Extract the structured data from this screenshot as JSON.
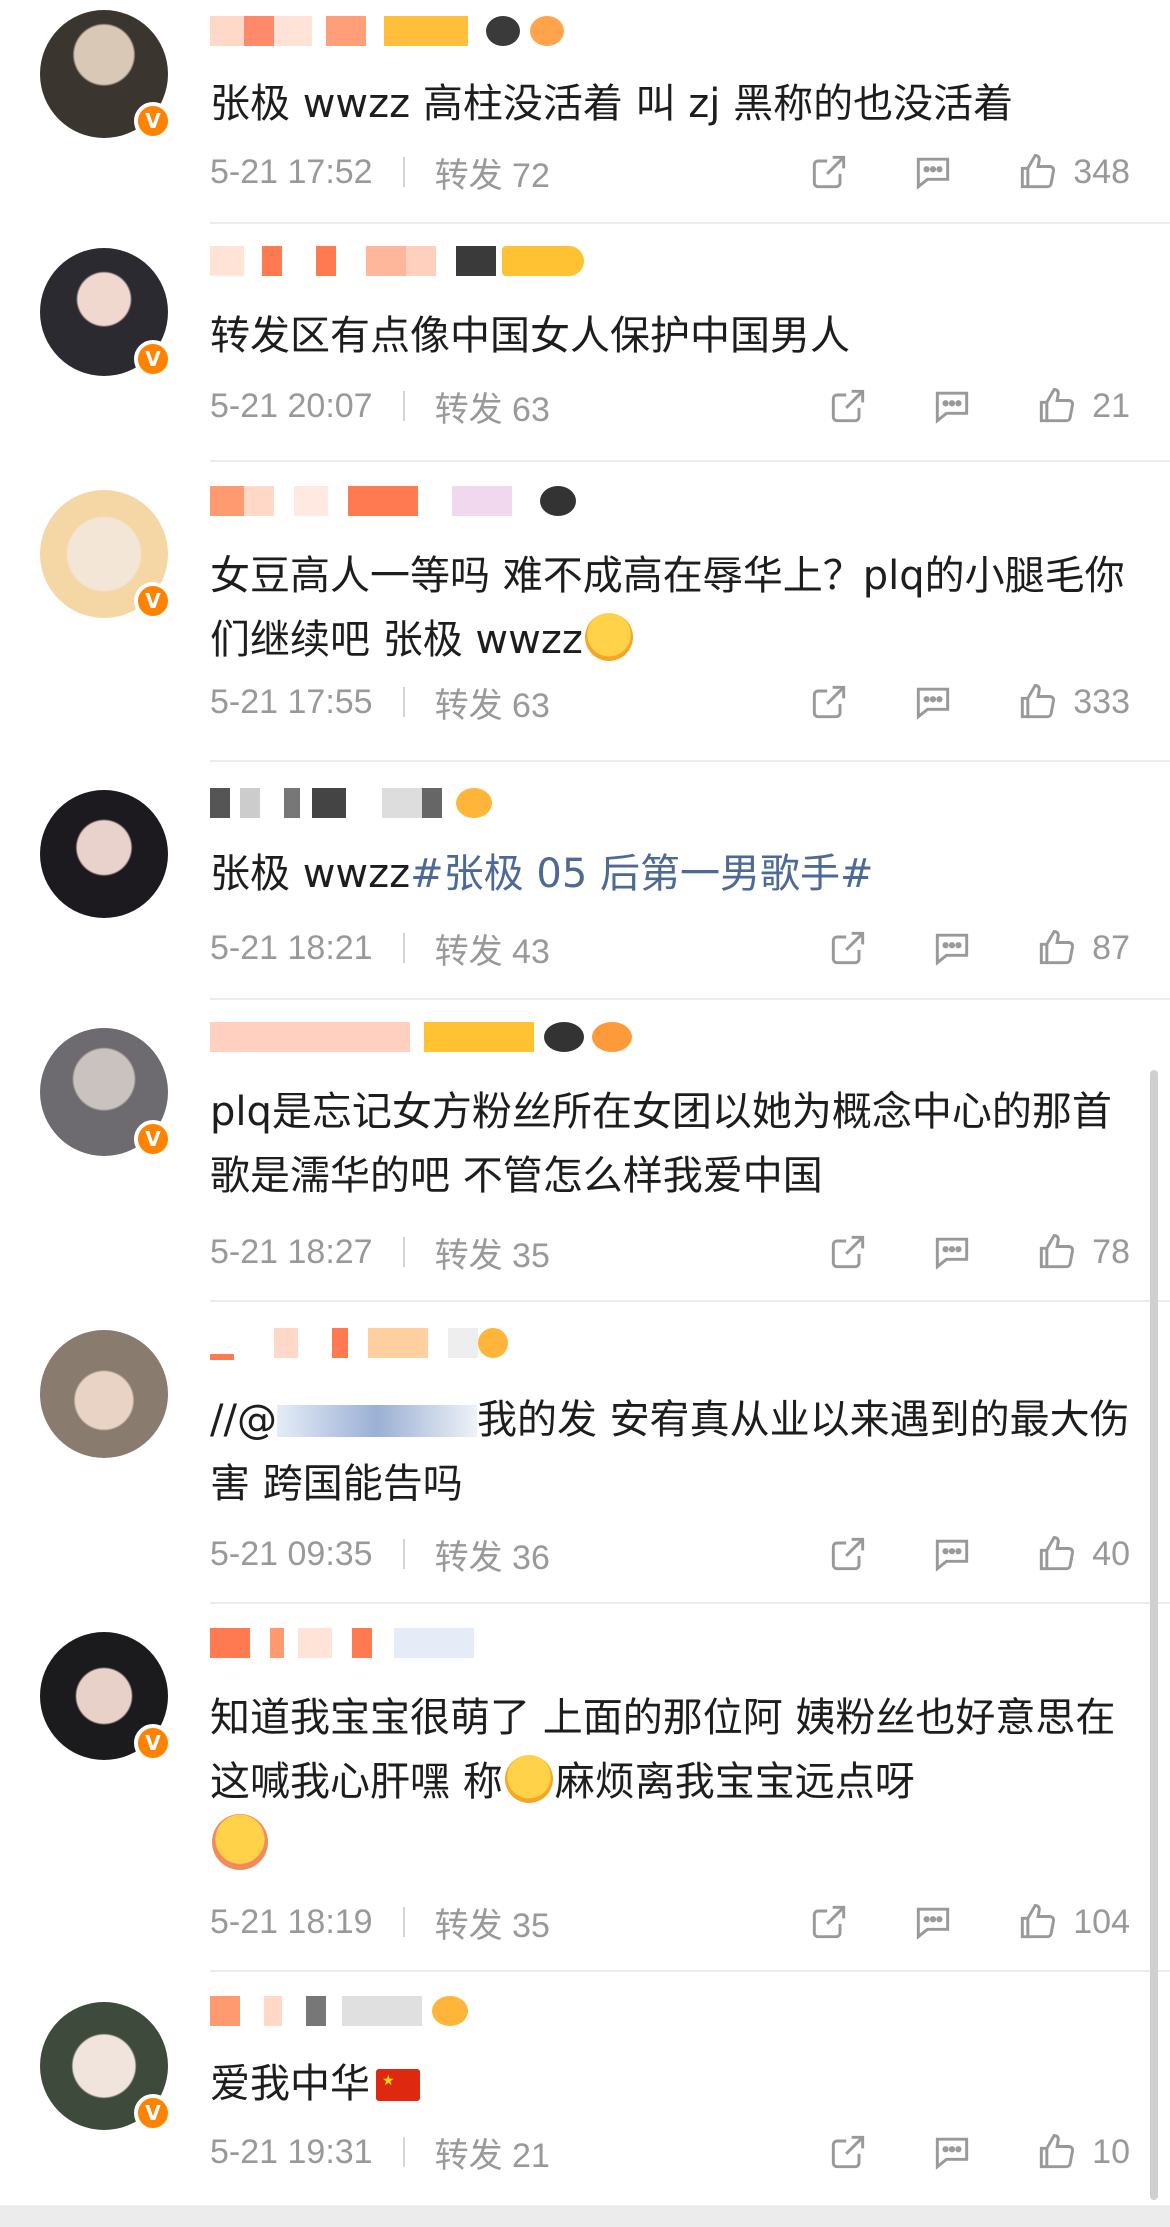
{
  "comments": [
    {
      "text": "张极 wwzz 高柱没活着 叫 zj 黑称的也没活着",
      "time": "5-21 17:52",
      "repost_label": "转发",
      "repost_count": "72",
      "likes": "348",
      "avatar_colors": [
        "#3b3530",
        "#d9c8b5"
      ]
    },
    {
      "text": "转发区有点像中国女人保护中国男人",
      "time": "5-21 20:07",
      "repost_label": "转发",
      "repost_count": "63",
      "likes": "21",
      "avatar_colors": [
        "#2a2a30",
        "#f1d8cf"
      ]
    },
    {
      "text": "女豆高人一等吗 难不成高在辱华上？plq的小腿毛你们继续吧 张极 wwzz",
      "time": "5-21 17:55",
      "repost_label": "转发",
      "repost_count": "63",
      "likes": "333",
      "avatar_colors": [
        "#f5d7a6",
        "#f3e6d6"
      ]
    },
    {
      "text_plain": "张极 wwzz",
      "text_tag": "#张极 05 后第一男歌手#",
      "time": "5-21 18:21",
      "repost_label": "转发",
      "repost_count": "43",
      "likes": "87",
      "avatar_colors": [
        "#1d1a1f",
        "#e9d2cb"
      ]
    },
    {
      "text": "plq是忘记女方粉丝所在女团以她为概念中心的那首歌是濡华的吧 不管怎么样我爱中国",
      "time": "5-21 18:27",
      "repost_label": "转发",
      "repost_count": "35",
      "likes": "78",
      "avatar_colors": [
        "#6d6a70",
        "#c9c2bf"
      ]
    },
    {
      "text_pre": "//@",
      "text_mid": "我的发 安宥真从业以来遇到的最大伤害 跨国能告吗",
      "time": "5-21 09:35",
      "repost_label": "转发",
      "repost_count": "36",
      "likes": "40",
      "avatar_colors": [
        "#8a7b6f",
        "#e8d3c4"
      ]
    },
    {
      "text_a": "知道我宝宝很萌了 上面的那位阿 姨粉丝也好意思在这喊我心肝嘿 称",
      "text_b": "麻烦离我宝宝远点呀",
      "time": "5-21 18:19",
      "repost_label": "转发",
      "repost_count": "35",
      "likes": "104",
      "avatar_colors": [
        "#1b1b1e",
        "#e7d1c9"
      ]
    },
    {
      "text": "爱我中华",
      "time": "5-21 19:31",
      "repost_label": "转发",
      "repost_count": "21",
      "likes": "10",
      "avatar_colors": [
        "#3d4a3c",
        "#f0e4dd"
      ]
    }
  ],
  "colors": {
    "accent_orange": "#ff8200",
    "meta_gray": "#999999",
    "tag_blue": "#4d6a97"
  },
  "icons": {
    "verified": "V",
    "repost": "share-icon",
    "comment": "comment-icon",
    "like": "thumbs-up-icon"
  }
}
